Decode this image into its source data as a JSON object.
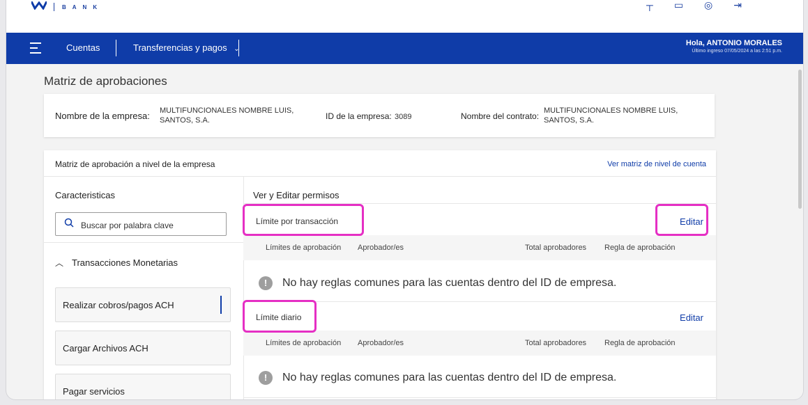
{
  "brand": {
    "name": "BANK",
    "color": "#0f3ca8"
  },
  "header": {
    "icons": [
      "notification-icon",
      "mail-icon",
      "settings-icon",
      "logout-icon"
    ],
    "nav": {
      "cuentas": "Cuentas",
      "transfers": "Transferencias y pagos"
    },
    "greeting": "Hola, ANTONIO MORALES",
    "last_login": "Último ingreso 07/05/2024 a las 2:51 p.m."
  },
  "page": {
    "title": "Matriz de aprobaciones"
  },
  "company": {
    "name_label": "Nombre de la empresa:",
    "name_line1": "MULTIFUNCIONALES NOMBRE LUIS,",
    "name_line2": "SANTOS, S.A.",
    "id_label": "ID de la empresa:",
    "id_value": "3089",
    "contract_label": "Nombre del contrato:",
    "contract_line1": "MULTIFUNCIONALES NOMBRE LUIS,",
    "contract_line2": "SANTOS, S.A."
  },
  "matrix": {
    "title": "Matriz de aprobación a nivel de la empresa",
    "account_link": "Ver matriz de nivel de cuenta",
    "left": {
      "title": "Caracteristicas",
      "search_placeholder": "Buscar por palabra clave",
      "category": "Transacciones Monetarias",
      "items": [
        "Realizar cobros/pagos ACH",
        "Cargar Archivos ACH",
        "Pagar servicios"
      ]
    },
    "right": {
      "title": "Ver y Editar permisos",
      "columns": [
        "Límites de aprobación",
        "Aprobador/es",
        "Total aprobadores",
        "Regla de aprobación"
      ],
      "edit_label": "Editar",
      "sections": [
        {
          "label": "Límite por transacción",
          "empty_message": "No hay reglas comunes para las cuentas dentro del ID de empresa."
        },
        {
          "label": "Límite diario",
          "empty_message": "No hay reglas comunes para las cuentas dentro del ID de empresa."
        }
      ]
    }
  },
  "highlight_color": "#e52fc4"
}
